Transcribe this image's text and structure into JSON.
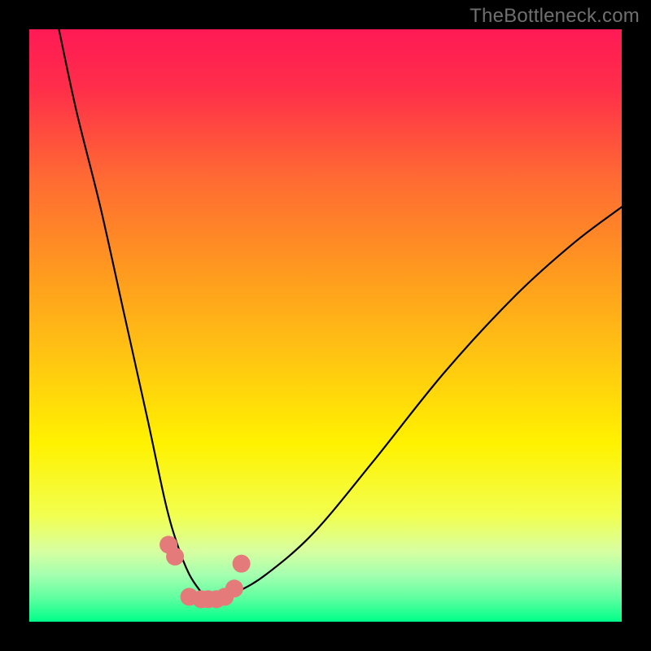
{
  "watermark": "TheBottleneck.com",
  "colors": {
    "frame": "#000000",
    "gradient_stops": [
      {
        "offset": 0.0,
        "color": "#ff1a55"
      },
      {
        "offset": 0.1,
        "color": "#ff2e4a"
      },
      {
        "offset": 0.25,
        "color": "#ff6a33"
      },
      {
        "offset": 0.4,
        "color": "#ff9720"
      },
      {
        "offset": 0.55,
        "color": "#ffc412"
      },
      {
        "offset": 0.7,
        "color": "#fff200"
      },
      {
        "offset": 0.82,
        "color": "#f2ff4f"
      },
      {
        "offset": 0.88,
        "color": "#d8ffa0"
      },
      {
        "offset": 0.92,
        "color": "#a6ffb0"
      },
      {
        "offset": 0.96,
        "color": "#5fffa0"
      },
      {
        "offset": 1.0,
        "color": "#00ff8a"
      }
    ],
    "curve": "#000000",
    "dots": "#e47a7a"
  },
  "chart_data": {
    "type": "line",
    "title": "",
    "xlabel": "",
    "ylabel": "",
    "xlim": [
      0,
      100
    ],
    "ylim": [
      0,
      100
    ],
    "grid": false,
    "series": [
      {
        "name": "bottleneck-curve",
        "x": [
          5,
          8,
          12,
          16,
          20,
          23,
          25,
          27,
          29,
          30,
          32,
          35,
          40,
          48,
          58,
          70,
          82,
          92,
          100
        ],
        "y": [
          100,
          86,
          70,
          52,
          34,
          20,
          13,
          8,
          5,
          4,
          4,
          5,
          8,
          15,
          27,
          42,
          55,
          64,
          70
        ]
      }
    ],
    "markers": {
      "name": "highlight-dots",
      "x": [
        23.5,
        24.6,
        27.0,
        29.0,
        30.2,
        31.6,
        33.0,
        34.6,
        35.8
      ],
      "y": [
        13.0,
        11.0,
        4.2,
        3.8,
        3.8,
        3.8,
        4.2,
        5.6,
        9.8
      ]
    }
  }
}
